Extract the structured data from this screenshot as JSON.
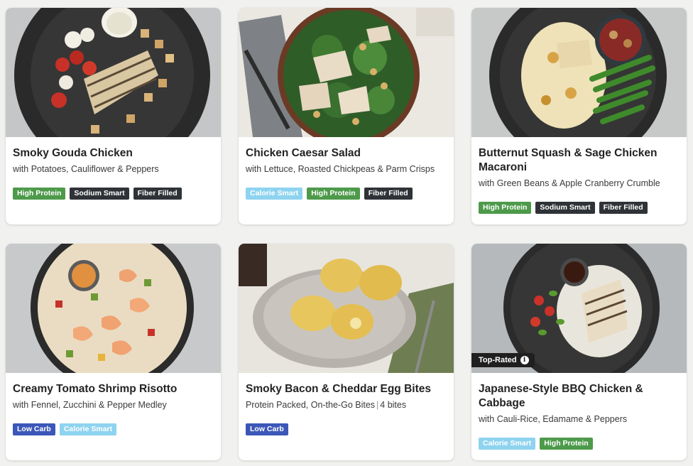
{
  "meals": [
    {
      "title": "Smoky Gouda Chicken",
      "subtitle": "with Potatoes, Cauliflower & Peppers",
      "tags": [
        {
          "label": "High Protein",
          "color": "#4d9a4a"
        },
        {
          "label": "Sodium Smart",
          "color": "#2f3337"
        },
        {
          "label": "Fiber Filled",
          "color": "#2f3337"
        }
      ]
    },
    {
      "title": "Chicken Caesar Salad",
      "subtitle": "with Lettuce, Roasted Chickpeas & Parm Crisps",
      "tags": [
        {
          "label": "Calorie Smart",
          "color": "#8ed3ef"
        },
        {
          "label": "High Protein",
          "color": "#4d9a4a"
        },
        {
          "label": "Fiber Filled",
          "color": "#2f3337"
        }
      ]
    },
    {
      "title": "Butternut Squash & Sage Chicken Macaroni",
      "subtitle": "with Green Beans & Apple Cranberry Crumble",
      "tags": [
        {
          "label": "High Protein",
          "color": "#4d9a4a"
        },
        {
          "label": "Sodium Smart",
          "color": "#2f3337"
        },
        {
          "label": "Fiber Filled",
          "color": "#2f3337"
        }
      ]
    },
    {
      "title": "Creamy Tomato Shrimp Risotto",
      "subtitle": "with Fennel, Zucchini & Pepper Medley",
      "tags": [
        {
          "label": "Low Carb",
          "color": "#3c57b8"
        },
        {
          "label": "Calorie Smart",
          "color": "#8ed3ef"
        }
      ]
    },
    {
      "title": "Smoky Bacon & Cheddar Egg Bites",
      "subtitle": "Protein Packed, On-the-Go Bites",
      "subtitle_extra": "4 bites",
      "tags": [
        {
          "label": "Low Carb",
          "color": "#3c57b8"
        }
      ]
    },
    {
      "title": "Japanese-Style BBQ Chicken & Cabbage",
      "subtitle": "with Cauli-Rice, Edamame & Peppers",
      "badge": "Top-Rated",
      "tags": [
        {
          "label": "Calorie Smart",
          "color": "#8ed3ef"
        },
        {
          "label": "High Protein",
          "color": "#4d9a4a"
        }
      ]
    }
  ]
}
